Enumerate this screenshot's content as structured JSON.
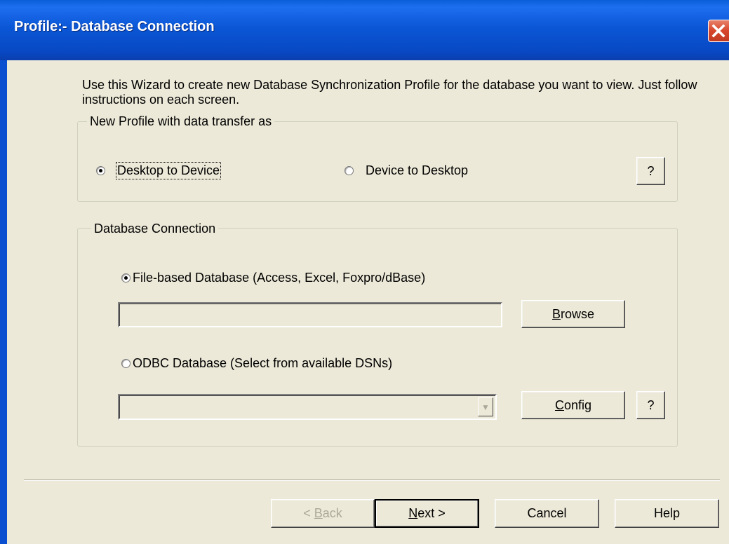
{
  "window": {
    "title": "Profile:- Database Connection"
  },
  "intro": "Use this Wizard to create new Database Synchronization Profile for the database you want to view. Just follow instructions on each screen.",
  "transfer_group": {
    "label": "New Profile with data transfer as",
    "options": [
      {
        "label": "Desktop to Device",
        "checked": true
      },
      {
        "label": "Device to Desktop",
        "checked": false
      }
    ],
    "help_label": "?"
  },
  "connection_group": {
    "label": "Database Connection",
    "file_option": {
      "label": "File-based Database (Access, Excel, Foxpro/dBase)",
      "checked": true
    },
    "file_path_value": "",
    "browse_label_pre": "",
    "browse_label_key": "B",
    "browse_label_post": "rowse",
    "odbc_option": {
      "label": "ODBC Database (Select from available DSNs)",
      "checked": false
    },
    "dsn_value": "",
    "config_label_key": "C",
    "config_label_post": "onfig",
    "help_label": "?"
  },
  "footer": {
    "back": {
      "pre": "< ",
      "key": "B",
      "post": "ack",
      "enabled": false
    },
    "next": {
      "key": "N",
      "post": "ext >"
    },
    "cancel": "Cancel",
    "help": "Help"
  }
}
